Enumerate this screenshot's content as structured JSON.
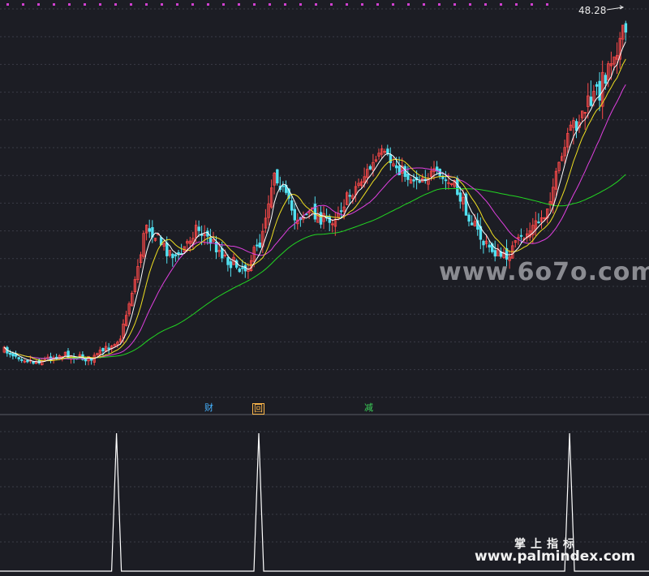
{
  "chart_data": [
    {
      "type": "candlestick",
      "last_price_label": "48.28",
      "markers": [
        {
          "text": "财",
          "color": "#46b3ff",
          "bar": 70
        },
        {
          "text": "回",
          "color": "#ffb84a",
          "bar": 87
        },
        {
          "text": "减",
          "color": "#3cd65a",
          "bar": 125
        }
      ],
      "ma_colors": {
        "ma5": "#ffffff",
        "ma10": "#f0e021",
        "ma20": "#e040e0",
        "ma60": "#22d622"
      },
      "up_color": "#ff4a4a",
      "down_color": "#52e0f0",
      "grid": true
    },
    {
      "type": "line",
      "spikes_at_bar": [
        39,
        88,
        195
      ],
      "line_color": "#ffffff"
    }
  ],
  "watermarks": {
    "top": "www.6o7o.com",
    "bottom_cn": "掌上指标",
    "bottom_url": "www.palmindex.com"
  }
}
